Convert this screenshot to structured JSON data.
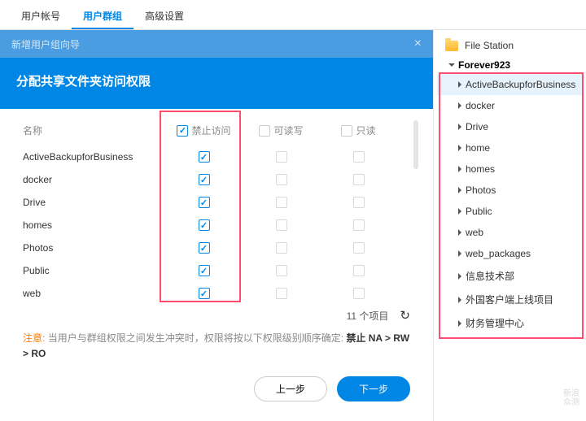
{
  "tabs": {
    "account": "用户帐号",
    "group": "用户群组",
    "advanced": "高级设置"
  },
  "wizard": {
    "title": "新增用户组向导",
    "header": "分配共享文件夹访问权限"
  },
  "columns": {
    "name": "名称",
    "na": "禁止访问",
    "rw": "可读写",
    "ro": "只读"
  },
  "rows": [
    {
      "name": "ActiveBackupforBusiness"
    },
    {
      "name": "docker"
    },
    {
      "name": "Drive"
    },
    {
      "name": "homes"
    },
    {
      "name": "Photos"
    },
    {
      "name": "Public"
    },
    {
      "name": "web"
    }
  ],
  "footer": {
    "count": "11 个项目"
  },
  "note": {
    "label": "注意:",
    "text": "当用户与群组权限之间发生冲突时，权限将按以下权限级别顺序确定:",
    "rule": "禁止 NA > RW > RO"
  },
  "buttons": {
    "prev": "上一步",
    "next": "下一步"
  },
  "fileStation": {
    "title": "File Station",
    "root": "Forever923",
    "items": [
      "ActiveBackupforBusiness",
      "docker",
      "Drive",
      "home",
      "homes",
      "Photos",
      "Public",
      "web",
      "web_packages",
      "信息技术部",
      "外国客户端上线项目",
      "财务管理中心"
    ]
  },
  "watermark": {
    "l1": "新浪",
    "l2": "众测"
  }
}
